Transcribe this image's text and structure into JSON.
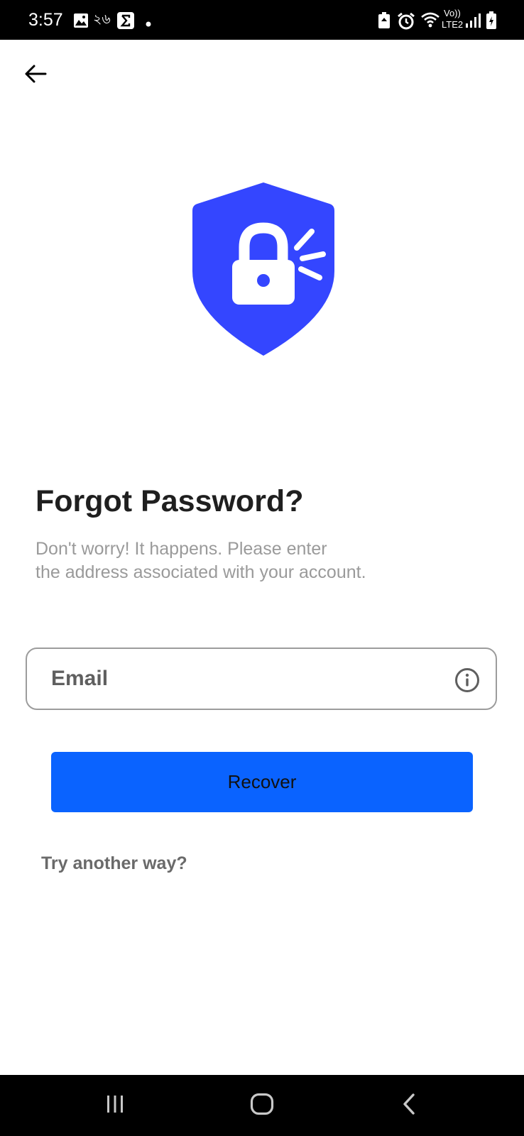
{
  "status_bar": {
    "time": "3:57",
    "notification_text": "২৬",
    "network_label": "Vo))",
    "network_sublabel": "LTE2",
    "icons": [
      "gallery-icon",
      "sigma-app-icon",
      "dot-icon",
      "battery-saver-icon",
      "alarm-icon",
      "wifi-icon",
      "signal-icon",
      "battery-charging-icon"
    ]
  },
  "header": {
    "back_icon": "arrow-left-icon"
  },
  "hero": {
    "icon": "shield-lock-icon",
    "color": "#3446ff"
  },
  "content": {
    "title": "Forgot Password?",
    "subtitle_line1": "Don't worry! It happens. Please enter",
    "subtitle_line2": "the address associated with your account."
  },
  "form": {
    "email_placeholder": "Email",
    "email_value": "",
    "info_icon": "info-circle-icon",
    "recover_label": "Recover",
    "alt_link": "Try another way?"
  },
  "colors": {
    "accent": "#0a63ff",
    "shield": "#3446ff"
  },
  "nav_bar": {
    "icons": [
      "recent-apps-icon",
      "home-icon",
      "back-nav-icon"
    ]
  }
}
